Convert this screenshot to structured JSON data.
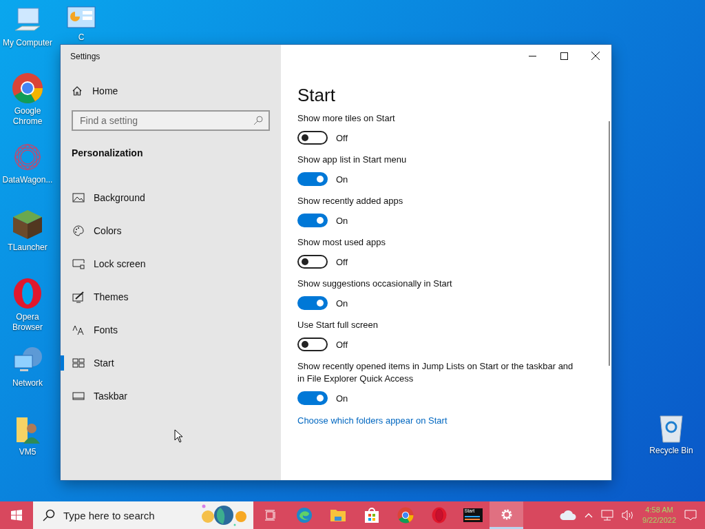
{
  "desktop_icons": [
    {
      "kind": "computer",
      "label": "My Computer"
    },
    {
      "kind": "control-panel",
      "label": "C"
    },
    {
      "kind": "chrome",
      "label": "Google Chrome"
    },
    {
      "kind": "datawagon",
      "label": "DataWagon..."
    },
    {
      "kind": "grass-block",
      "label": "TLauncher"
    },
    {
      "kind": "opera",
      "label": "Opera Browser"
    },
    {
      "kind": "network",
      "label": "Network"
    },
    {
      "kind": "user-folder",
      "label": "VM5"
    },
    {
      "kind": "recycle-bin",
      "label": "Recycle Bin"
    }
  ],
  "window": {
    "title": "Settings",
    "home": "Home",
    "search": {
      "placeholder": "Find a setting"
    },
    "section": "Personalization",
    "nav": [
      {
        "kind": "background",
        "label": "Background",
        "selected": false
      },
      {
        "kind": "colors",
        "label": "Colors",
        "selected": false
      },
      {
        "kind": "lock",
        "label": "Lock screen",
        "selected": false
      },
      {
        "kind": "themes",
        "label": "Themes",
        "selected": false
      },
      {
        "kind": "fonts",
        "label": "Fonts",
        "selected": false
      },
      {
        "kind": "start",
        "label": "Start",
        "selected": true
      },
      {
        "kind": "taskbar",
        "label": "Taskbar",
        "selected": false
      }
    ],
    "page_title": "Start",
    "settings": [
      {
        "label": "Show more tiles on Start",
        "on": false,
        "state_text": "Off"
      },
      {
        "label": "Show app list in Start menu",
        "on": true,
        "state_text": "On"
      },
      {
        "label": "Show recently added apps",
        "on": true,
        "state_text": "On"
      },
      {
        "label": "Show most used apps",
        "on": false,
        "state_text": "Off"
      },
      {
        "label": "Show suggestions occasionally in Start",
        "on": true,
        "state_text": "On"
      },
      {
        "label": "Use Start full screen",
        "on": false,
        "state_text": "Off"
      },
      {
        "label": "Show recently opened items in Jump Lists on Start or the taskbar and in File Explorer Quick Access",
        "on": true,
        "state_text": "On"
      }
    ],
    "link": "Choose which folders appear on Start"
  },
  "taskbar": {
    "search": {
      "placeholder": "Type here to search"
    },
    "apps": [
      {
        "kind": "task-view",
        "selected": false
      },
      {
        "kind": "edge",
        "selected": false
      },
      {
        "kind": "folder",
        "selected": false
      },
      {
        "kind": "store",
        "selected": false
      },
      {
        "kind": "chrome",
        "selected": false
      },
      {
        "kind": "opera",
        "selected": false
      },
      {
        "kind": "terminal",
        "label": "Start",
        "selected": false
      },
      {
        "kind": "settings",
        "selected": true
      }
    ],
    "time": "4:58 AM",
    "date": "9/22/2022"
  }
}
